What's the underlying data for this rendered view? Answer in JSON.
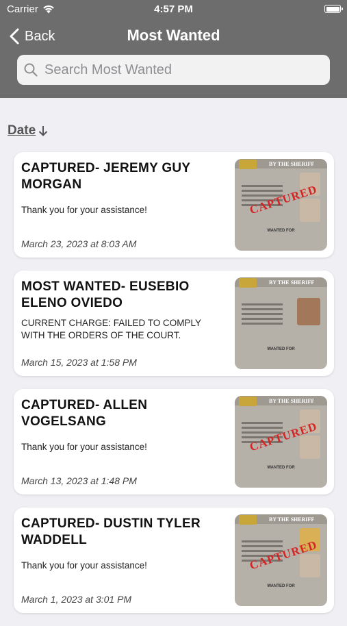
{
  "status_bar": {
    "carrier": "Carrier",
    "time": "4:57 PM"
  },
  "nav": {
    "back_label": "Back",
    "title": "Most Wanted"
  },
  "search": {
    "placeholder": "Search Most Wanted",
    "value": ""
  },
  "sort": {
    "label": "Date",
    "direction": "descending"
  },
  "items": [
    {
      "title": "CAPTURED- JEREMY GUY MORGAN",
      "body": "Thank you for your assistance!",
      "date": "March 23, 2023 at 8:03 AM",
      "thumb": {
        "header": "BY THE SHERIFF",
        "stamp": "CAPTURED",
        "footer": "WANTED FOR"
      }
    },
    {
      "title": "MOST WANTED- EUSEBIO ELENO OVIEDO",
      "body": "CURRENT CHARGE: FAILED TO COMPLY WITH THE ORDERS OF THE COURT.",
      "date": "March 15, 2023 at 1:58 PM",
      "thumb": {
        "header": "BY THE SHERIFF",
        "stamp": "",
        "footer": "WANTED FOR"
      }
    },
    {
      "title": "CAPTURED- ALLEN VOGELSANG",
      "body": "Thank you for your assistance!",
      "date": "March 13, 2023 at 1:48 PM",
      "thumb": {
        "header": "BY THE SHERIFF",
        "stamp": "CAPTURED",
        "footer": "WANTED FOR"
      }
    },
    {
      "title": "CAPTURED- DUSTIN TYLER WADDELL",
      "body": "Thank you for your assistance!",
      "date": "March 1, 2023 at 3:01 PM",
      "thumb": {
        "header": "BY THE SHERIFF",
        "stamp": "CAPTURED",
        "footer": "WANTED FOR"
      }
    }
  ],
  "colors": {
    "header_bg": "#6d6d6d",
    "page_bg": "#efeff4",
    "stamp": "#d42424"
  }
}
